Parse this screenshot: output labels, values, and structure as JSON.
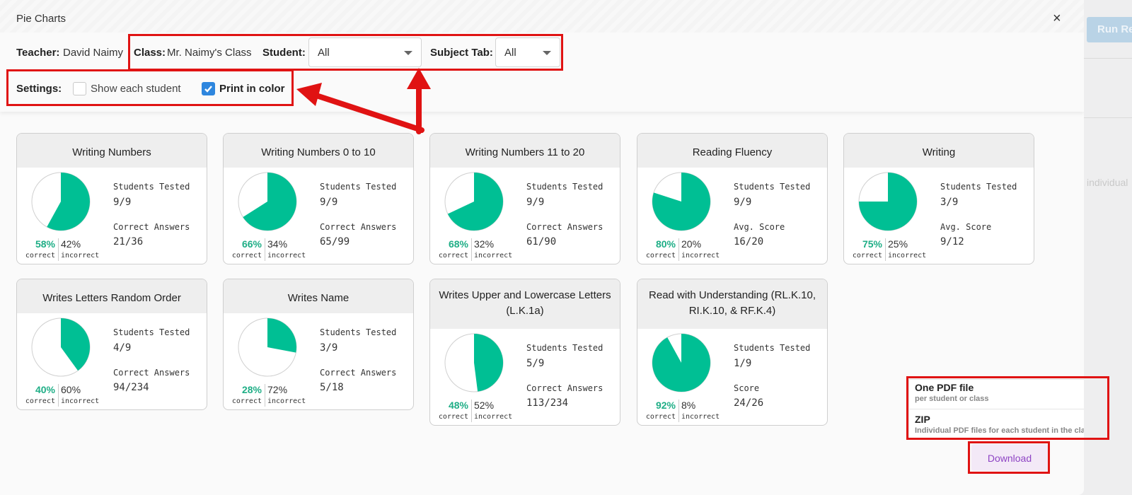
{
  "background": {
    "run_label": "Run Re",
    "side_text": "individual"
  },
  "modal": {
    "title": "Pie Charts",
    "close_icon": "×",
    "teacher_label": "Teacher:",
    "teacher_value": "David Naimy",
    "class_label": "Class:",
    "class_value": "Mr. Naimy's Class",
    "student_label": "Student:",
    "student_value": "All",
    "subject_label": "Subject Tab:",
    "subject_value": "All",
    "settings_label": "Settings:",
    "show_each_label": "Show each student",
    "show_each_checked": false,
    "print_color_label": "Print in color",
    "print_color_checked": true
  },
  "colors": {
    "correct": "#00bf94",
    "annotation": "#e01313",
    "checkbox": "#2e86de",
    "download": "#8e44c4"
  },
  "chart_data": [
    {
      "type": "pie",
      "title": "Writing Numbers",
      "correct_pct": 58,
      "incorrect_pct": 42,
      "correct_label": "58%",
      "incorrect_label": "42%",
      "stat1_label": "Students Tested",
      "stat1_value": "9/9",
      "stat2_label": "Correct Answers",
      "stat2_value": "21/36"
    },
    {
      "type": "pie",
      "title": "Writing Numbers 0 to 10",
      "correct_pct": 66,
      "incorrect_pct": 34,
      "correct_label": "66%",
      "incorrect_label": "34%",
      "stat1_label": "Students Tested",
      "stat1_value": "9/9",
      "stat2_label": "Correct Answers",
      "stat2_value": "65/99"
    },
    {
      "type": "pie",
      "title": "Writing Numbers 11 to 20",
      "correct_pct": 68,
      "incorrect_pct": 32,
      "correct_label": "68%",
      "incorrect_label": "32%",
      "stat1_label": "Students Tested",
      "stat1_value": "9/9",
      "stat2_label": "Correct Answers",
      "stat2_value": "61/90"
    },
    {
      "type": "pie",
      "title": "Reading Fluency",
      "correct_pct": 80,
      "incorrect_pct": 20,
      "correct_label": "80%",
      "incorrect_label": "20%",
      "stat1_label": "Students Tested",
      "stat1_value": "9/9",
      "stat2_label": "Avg. Score",
      "stat2_value": "16/20"
    },
    {
      "type": "pie",
      "title": "Writing",
      "correct_pct": 75,
      "incorrect_pct": 25,
      "correct_label": "75%",
      "incorrect_label": "25%",
      "stat1_label": "Students Tested",
      "stat1_value": "3/9",
      "stat2_label": "Avg. Score",
      "stat2_value": "9/12"
    },
    {
      "type": "pie",
      "title": "Writes Letters Random Order",
      "correct_pct": 40,
      "incorrect_pct": 60,
      "correct_label": "40%",
      "incorrect_label": "60%",
      "stat1_label": "Students Tested",
      "stat1_value": "4/9",
      "stat2_label": "Correct Answers",
      "stat2_value": "94/234"
    },
    {
      "type": "pie",
      "title": "Writes Name",
      "correct_pct": 28,
      "incorrect_pct": 72,
      "correct_label": "28%",
      "incorrect_label": "72%",
      "stat1_label": "Students Tested",
      "stat1_value": "3/9",
      "stat2_label": "Correct Answers",
      "stat2_value": "5/18"
    },
    {
      "type": "pie",
      "title": "Writes Upper and Lowercase Letters (L.K.1a)",
      "correct_pct": 48,
      "incorrect_pct": 52,
      "correct_label": "48%",
      "incorrect_label": "52%",
      "stat1_label": "Students Tested",
      "stat1_value": "5/9",
      "stat2_label": "Correct Answers",
      "stat2_value": "113/234"
    },
    {
      "type": "pie",
      "title": "Read with Understanding (RL.K.10, RI.K.10, & RF.K.4)",
      "correct_pct": 92,
      "incorrect_pct": 8,
      "correct_label": "92%",
      "incorrect_label": "8%",
      "stat1_label": "Students Tested",
      "stat1_value": "1/9",
      "stat2_label": "Score",
      "stat2_value": "24/26"
    }
  ],
  "card_text": {
    "correct_sub": "correct",
    "incorrect_sub": "incorrect"
  },
  "download_menu": {
    "option1_title": "One PDF file",
    "option1_sub": "per student or class",
    "option2_title": "ZIP",
    "option2_sub": "Individual PDF files for each student in the class",
    "button_label": "Download"
  }
}
